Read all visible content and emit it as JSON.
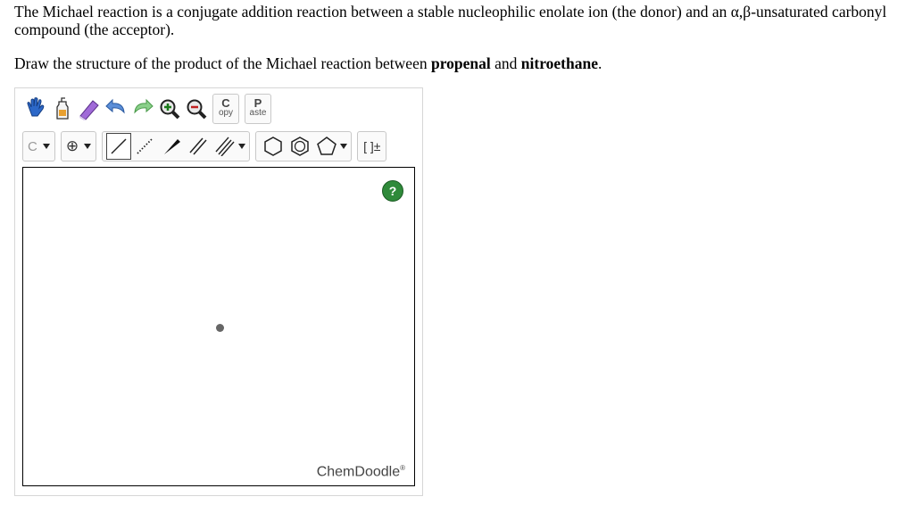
{
  "question": {
    "paragraph1": "The Michael reaction is a conjugate addition reaction between a stable nucleophilic enolate ion (the donor) and an α,β-unsaturated carbonyl compound (the acceptor).",
    "p2_prefix": "Draw the structure of the product of the Michael reaction between ",
    "p2_bold1": "propenal",
    "p2_mid": " and ",
    "p2_bold2": "nitroethane",
    "p2_suffix": "."
  },
  "toolbar": {
    "copy_top": "C",
    "copy_bottom": "opy",
    "paste_top": "P",
    "paste_bottom": "aste",
    "atom_label": "C",
    "charge_label": "⊕",
    "bracket_label": "[ ]±"
  },
  "canvas": {
    "help_label": "?",
    "brand": "ChemDoodle",
    "brand_mark": "®"
  },
  "icons": [
    "hand-icon",
    "erase-bottle-icon",
    "eraser-icon",
    "undo-icon",
    "redo-icon",
    "zoom-in-icon",
    "zoom-out-icon"
  ]
}
